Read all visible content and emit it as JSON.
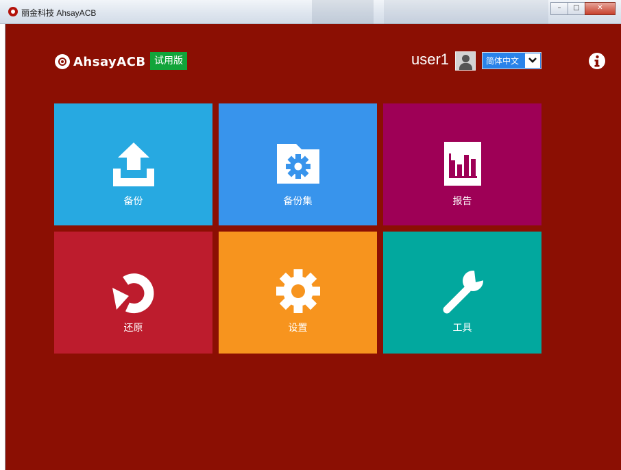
{
  "window": {
    "title": "丽金科技 AhsayACB",
    "background": "#8b0f03",
    "controls": [
      "minimize",
      "maximize",
      "close"
    ]
  },
  "header": {
    "logo_text": "AhsayACB",
    "trial_badge": "试用版",
    "username": "user1",
    "language": {
      "selected": "简体中文"
    },
    "info_icon": "info-circle-icon"
  },
  "tiles": [
    {
      "label": "备份",
      "icon": "upload-icon",
      "color": "#27a9e1"
    },
    {
      "label": "备份集",
      "icon": "folder-gear-icon",
      "color": "#3894ec"
    },
    {
      "label": "报告",
      "icon": "bar-chart-icon",
      "color": "#9e0056"
    },
    {
      "label": "还原",
      "icon": "restore-arrow-icon",
      "color": "#bd1c2d"
    },
    {
      "label": "设置",
      "icon": "gear-icon",
      "color": "#f7941e"
    },
    {
      "label": "工具",
      "icon": "wrench-icon",
      "color": "#02a89e"
    }
  ]
}
